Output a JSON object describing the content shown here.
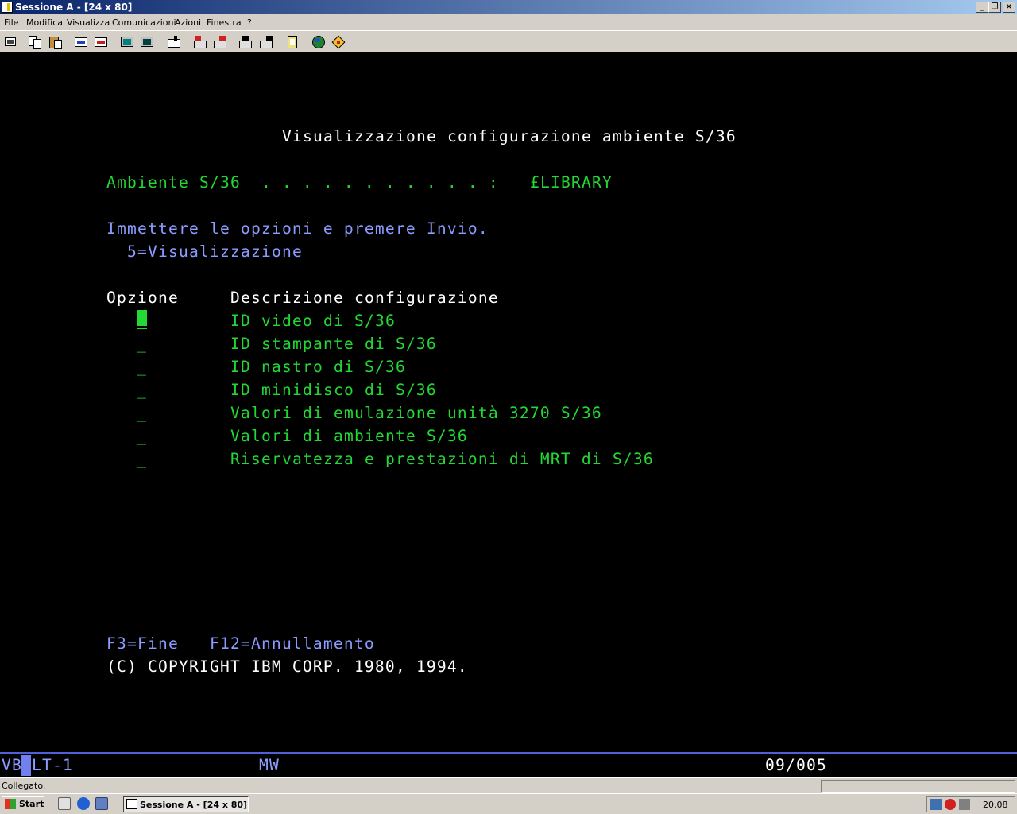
{
  "window": {
    "title": "Sessione A - [24 x 80]",
    "controls": {
      "minimize": "_",
      "restore": "❐",
      "close": "×"
    }
  },
  "menu": {
    "items": [
      "File",
      "Modifica",
      "Visualizza",
      "Comunicazioni",
      "Azioni",
      "Finestra",
      "?"
    ]
  },
  "toolbar": {
    "icons": [
      "print-screen-icon",
      "copy-icon",
      "paste-icon",
      "send-icon",
      "receive-icon",
      "display-icon",
      "keyboard-icon",
      "macro-icon",
      "play-icon",
      "record-icon",
      "stop-icon",
      "clipboard-icon",
      "globe-icon",
      "tag-icon"
    ]
  },
  "terminal": {
    "title": "Visualizzazione configurazione ambiente S/36",
    "env_label": "Ambiente S/36  . . . . . . . . . . . :",
    "env_value": "£LIBRARY",
    "instruction": "Immettere le opzioni e premere Invio.",
    "option_hint": "5=Visualizzazione",
    "col_option": "Opzione",
    "col_desc": "Descrizione configurazione",
    "rows": [
      {
        "option": "_",
        "desc": "ID video di S/36"
      },
      {
        "option": "_",
        "desc": "ID stampante di S/36"
      },
      {
        "option": "_",
        "desc": "ID nastro di S/36"
      },
      {
        "option": "_",
        "desc": "ID minidisco di S/36"
      },
      {
        "option": "_",
        "desc": "Valori di emulazione unità 3270 S/36"
      },
      {
        "option": "_",
        "desc": "Valori di ambiente S/36"
      },
      {
        "option": "_",
        "desc": "Riservatezza e prestazioni di MRT di S/36"
      }
    ],
    "fkeys": "F3=Fine   F12=Annullamento",
    "copyright": "(C) COPYRIGHT IBM CORP. 1980, 1994."
  },
  "oia": {
    "left": "VB",
    "session": "LT-1",
    "mode": "MW",
    "cursor_pos": "09/005"
  },
  "status": {
    "message": "Collegato."
  },
  "taskbar": {
    "start": "Start",
    "task": "Sessione A - [24 x 80]",
    "clock": "20.08"
  },
  "colors": {
    "green": "#22d834",
    "blue": "#8c9cff",
    "white": "#ffffff",
    "background": "#000000"
  }
}
